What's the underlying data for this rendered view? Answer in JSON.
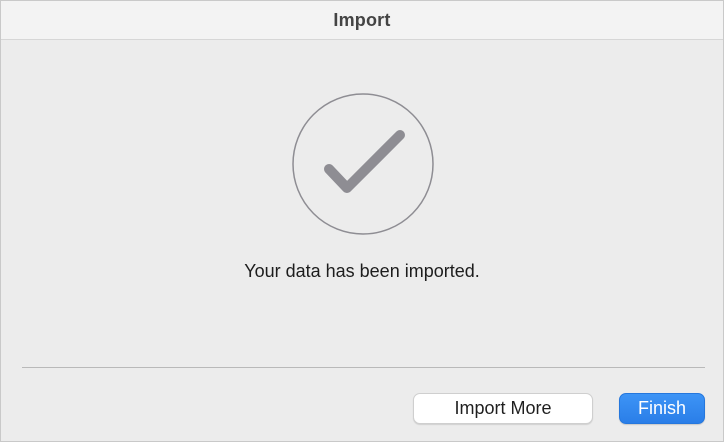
{
  "window": {
    "title": "Import"
  },
  "status": {
    "icon": "checkmark-circle-icon",
    "message": "Your data has been imported."
  },
  "actions": {
    "import_more_label": "Import More",
    "finish_label": "Finish"
  },
  "colors": {
    "accent": "#2a7ee8",
    "icon_stroke": "#8e8d93",
    "background": "#ececec"
  }
}
